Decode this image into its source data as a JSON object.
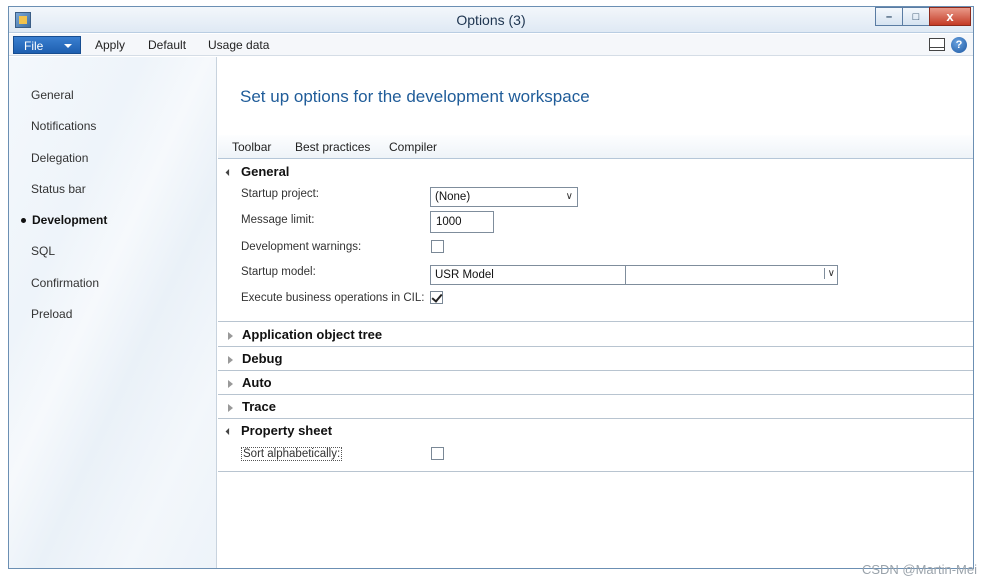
{
  "window": {
    "title": "Options (3)",
    "minimize": "–",
    "maximize": "□",
    "close": "x"
  },
  "menubar": {
    "file": "File",
    "items": [
      "Apply",
      "Default",
      "Usage data"
    ]
  },
  "sidebar": {
    "items": [
      "General",
      "Notifications",
      "Delegation",
      "Status bar",
      "Development",
      "SQL",
      "Confirmation",
      "Preload"
    ],
    "active": "Development"
  },
  "main": {
    "heading": "Set up options for the development workspace",
    "subtabs": [
      "Toolbar",
      "Best practices",
      "Compiler"
    ],
    "general": {
      "title": "General",
      "startup_project_label": "Startup project:",
      "startup_project_value": "(None)",
      "message_limit_label": "Message limit:",
      "message_limit_value": "1000",
      "dev_warnings_label": "Development warnings:",
      "dev_warnings_checked": false,
      "startup_model_label": "Startup model:",
      "startup_model_value": "USR Model",
      "exec_cil_label": "Execute business operations in CIL:",
      "exec_cil_checked": true
    },
    "collapsed_sections": [
      "Application object tree",
      "Debug",
      "Auto",
      "Trace"
    ],
    "property_sheet": {
      "title": "Property sheet",
      "sort_label": "Sort alphabetically:",
      "sort_checked": false
    }
  },
  "watermark": "CSDN @Martin-Mei",
  "icons": {
    "app": "options-app-icon",
    "pane": "pane-toggle-icon",
    "help": "help-icon",
    "dropdown": "chevron-down-icon"
  }
}
